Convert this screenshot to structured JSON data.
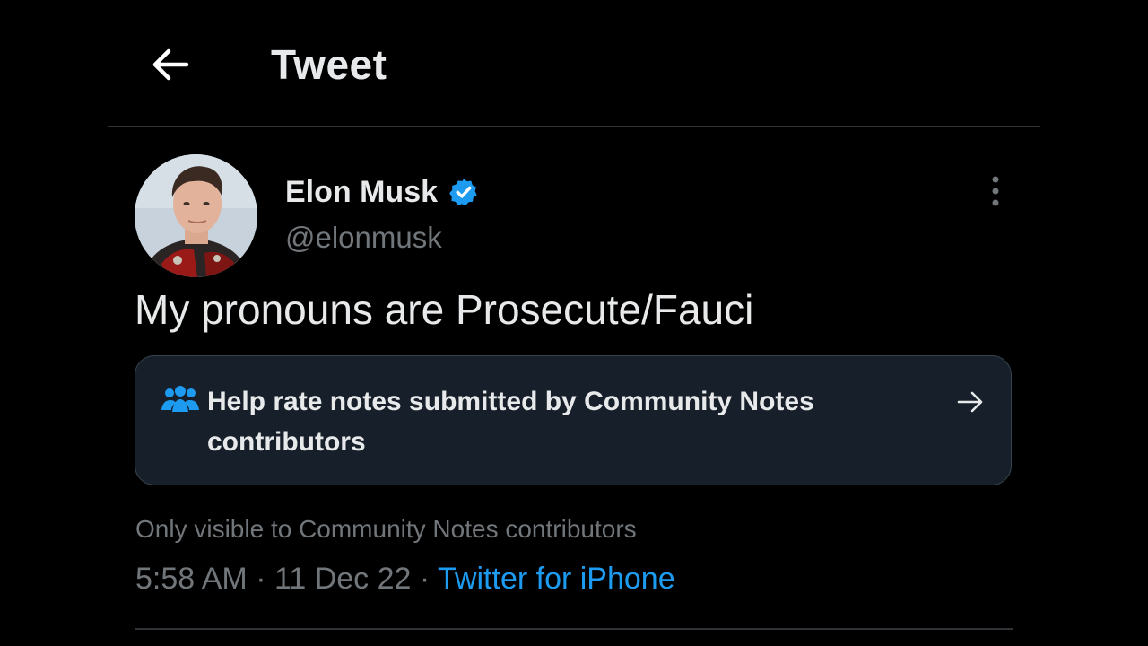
{
  "header": {
    "title": "Tweet",
    "back_icon": "arrow-left-icon"
  },
  "tweet": {
    "author": {
      "display_name": "Elon Musk",
      "handle": "@elonmusk",
      "verified": true,
      "verified_icon": "verified-badge-icon",
      "avatar": "avatar-photo"
    },
    "more_icon": "more-vertical-icon",
    "text": "My pronouns are Prosecute/Fauci",
    "community_notes_card": {
      "icon": "people-icon",
      "text": "Help rate notes submitted by Community Notes contributors",
      "arrow_icon": "arrow-right-icon"
    },
    "visibility_note": "Only visible to Community Notes contributors",
    "meta": {
      "time": "5:58 AM",
      "separator": " · ",
      "date": "11 Dec 22",
      "source": "Twitter for iPhone"
    }
  },
  "colors": {
    "background": "#000000",
    "primary_text": "#e7e9ea",
    "secondary_text": "#71767b",
    "accent": "#1d9bf0",
    "card_background": "#17202a",
    "divider": "#2f3336"
  }
}
